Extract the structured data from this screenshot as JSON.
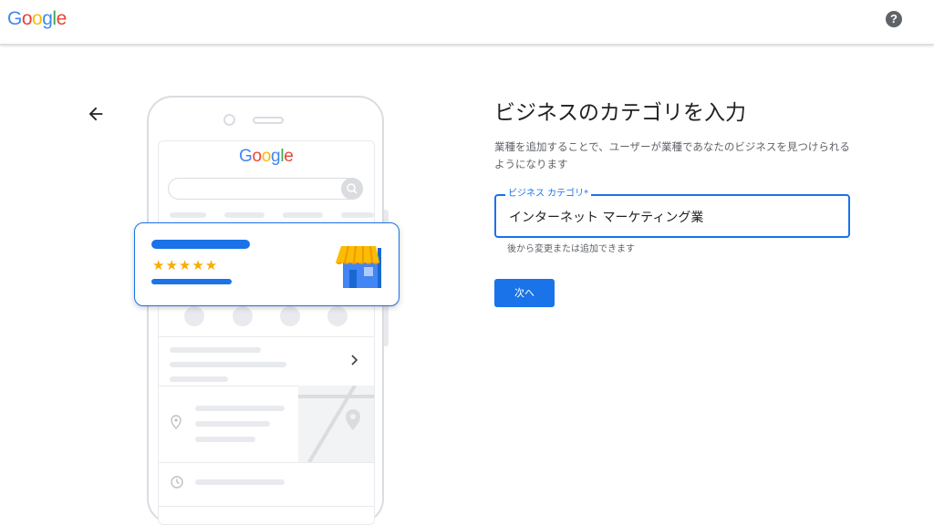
{
  "header": {
    "logo_letters": [
      {
        "ch": "G",
        "color": "#4285F4"
      },
      {
        "ch": "o",
        "color": "#EA4335"
      },
      {
        "ch": "o",
        "color": "#FBBC05"
      },
      {
        "ch": "g",
        "color": "#4285F4"
      },
      {
        "ch": "l",
        "color": "#34A853"
      },
      {
        "ch": "e",
        "color": "#EA4335"
      }
    ],
    "help_icon": "help-icon",
    "help_glyph": "?"
  },
  "nav": {
    "back_icon": "arrow-left-icon"
  },
  "illustration": {
    "phone_logo": "Google",
    "star_glyphs": "★★★★★",
    "rating_stars": 5,
    "store_icon": "storefront-icon",
    "colors": {
      "accent": "#1a73e8",
      "star": "#f9ab00",
      "awning": "#fbbc04",
      "store": "#4285f4"
    }
  },
  "form": {
    "title": "ビジネスのカテゴリを入力",
    "description": "業種を追加することで、ユーザーが業種であなたのビジネスを見つけられるようになります",
    "field_label": "ビジネス カテゴリ*",
    "field_value": "インターネット マーケティング業",
    "helper_text": "後から変更または追加できます",
    "next_label": "次へ"
  }
}
